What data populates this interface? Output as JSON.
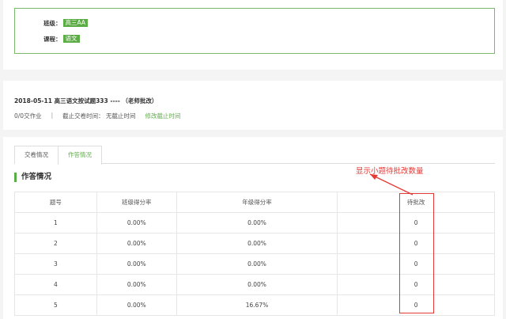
{
  "info": {
    "class_label": "班级：",
    "class_value": "高三AA",
    "course_label": "课程：",
    "course_value": "语文"
  },
  "homework": {
    "title": "2018-05-11 高三语文按试题333 ---- （老师批改）",
    "submitted": "0/0交作业",
    "separator": "|",
    "deadline": "截止交卷时间：  无截止时间",
    "edit_deadline": "修改截止时间"
  },
  "tabs": [
    {
      "label": "交卷情况",
      "active": false
    },
    {
      "label": "作答情况",
      "active": true
    }
  ],
  "section_title": "作答情况",
  "annotation": "显示小题待批改数量",
  "table": {
    "headers": [
      "题号",
      "班级得分率",
      "年级得分率",
      "待批改"
    ],
    "rows": [
      [
        "1",
        "0.00%",
        "0.00%",
        "0"
      ],
      [
        "2",
        "0.00%",
        "0.00%",
        "0"
      ],
      [
        "3",
        "0.00%",
        "0.00%",
        "0"
      ],
      [
        "4",
        "0.00%",
        "0.00%",
        "0"
      ],
      [
        "5",
        "0.00%",
        "16.67%",
        "0"
      ]
    ]
  },
  "colors": {
    "accent": "#5cad45",
    "annotation": "#e53935"
  }
}
